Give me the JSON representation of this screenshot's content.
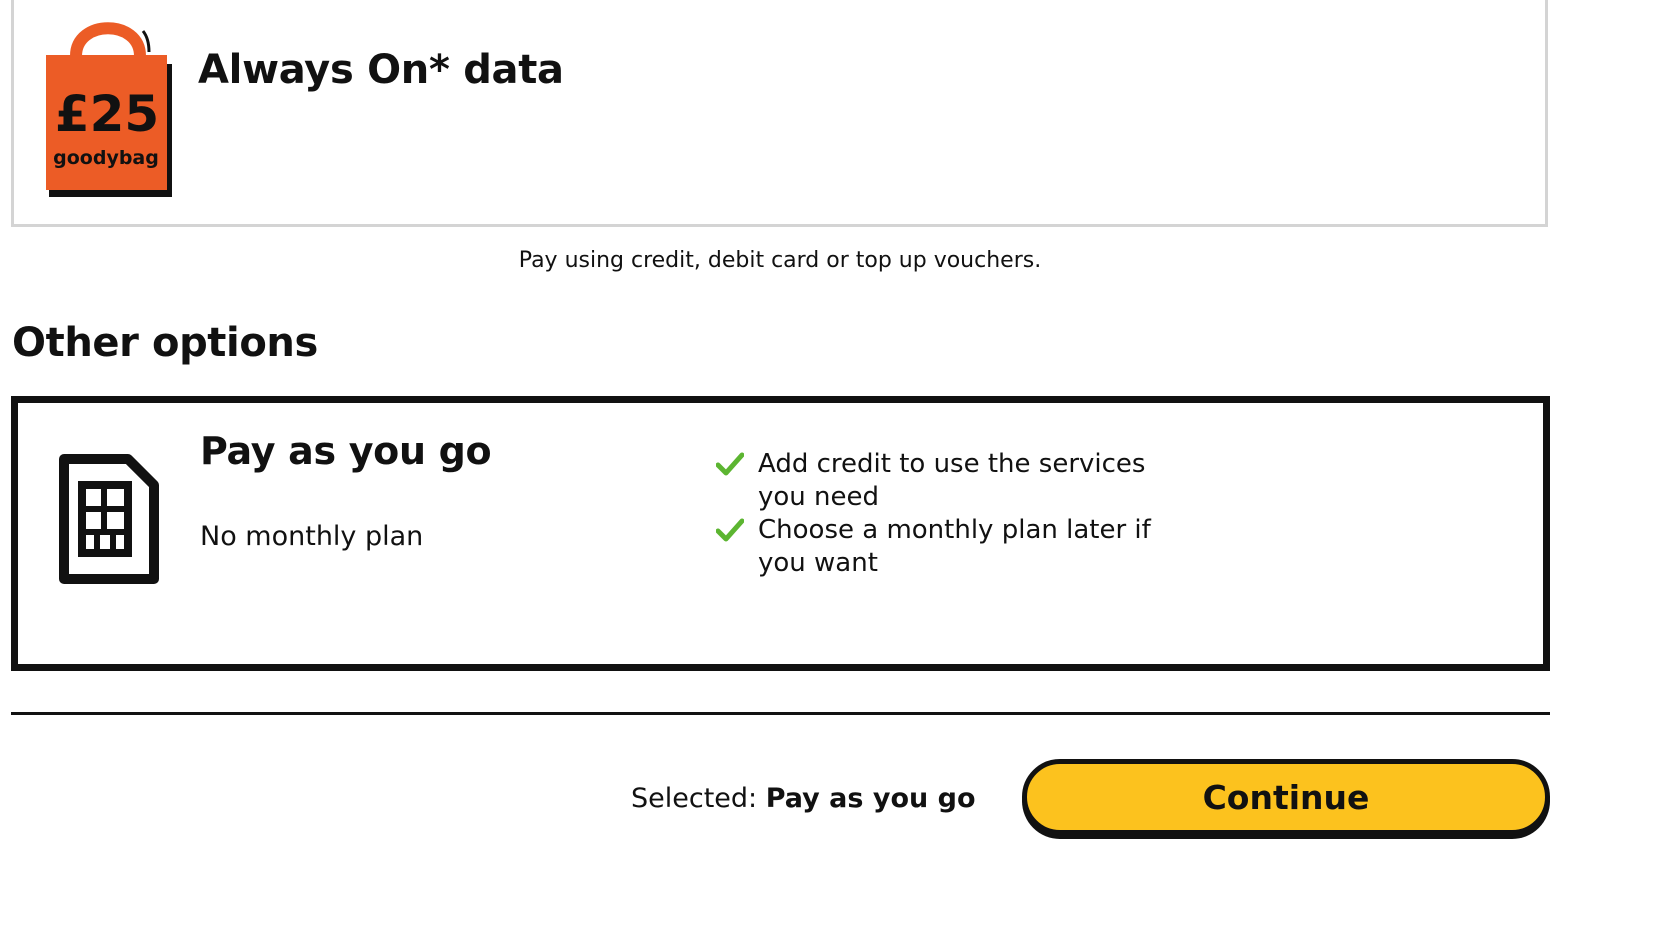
{
  "goodybag": {
    "amount": "£25",
    "brand": "goodybag",
    "title": "Always On* data",
    "colors": {
      "bag": "#ec5c26",
      "outline": "#111111"
    }
  },
  "payment_note": "Pay using credit, debit card or top up vouchers.",
  "other_options": {
    "heading": "Other options",
    "options": [
      {
        "title": "Pay as you go",
        "subtitle": "No monthly plan",
        "icon": "sim-card-icon",
        "features": [
          "Add credit to use the services you need",
          "Choose a monthly plan later if you want"
        ]
      }
    ]
  },
  "footer": {
    "selected_label": "Selected:",
    "selected_value": "Pay as you go",
    "continue_label": "Continue",
    "continue_color": "#fcc21e"
  },
  "colors": {
    "check": "#5cb531",
    "divider": "#111111",
    "card_border_light": "#d4d4d4"
  }
}
